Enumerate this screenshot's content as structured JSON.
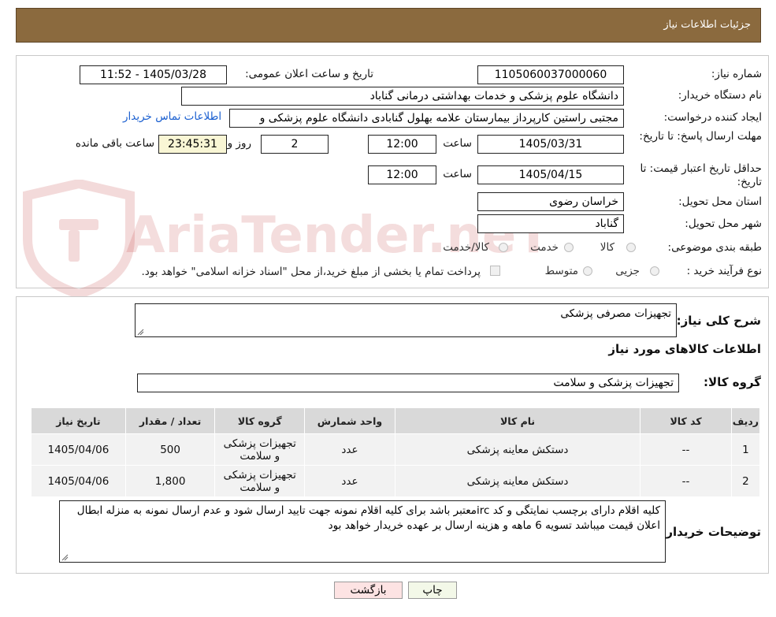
{
  "header": {
    "title": "جزئیات اطلاعات نیاز"
  },
  "watermark": {
    "text": "AriaTender.neT"
  },
  "form": {
    "need_number_label": "شماره نیاز:",
    "need_number": "1105060037000060",
    "announce_label": "تاریخ و ساعت اعلان عمومی:",
    "announce_value": "1405/03/28 - 11:52",
    "buyer_org_label": "نام دستگاه خریدار:",
    "buyer_org": "دانشگاه علوم پزشکی و خدمات بهداشتی درمانی گناباد",
    "creator_label": "ایجاد کننده درخواست:",
    "creator": "مجتبی راستین کارپرداز بیمارستان علامه بهلول گنابادی دانشگاه علوم پزشکی و",
    "contact_link": "اطلاعات تماس خریدار",
    "deadline_label": "مهلت ارسال پاسخ: تا تاریخ:",
    "deadline_date": "1405/03/31",
    "time_label": "ساعت",
    "deadline_time": "12:00",
    "days": "2",
    "days_label": "روز و",
    "remaining": "23:45:31",
    "remaining_label": "ساعت باقی مانده",
    "validity_label": "حداقل تاریخ اعتبار قیمت: تا تاریخ:",
    "validity_date": "1405/04/15",
    "validity_time": "12:00",
    "province_label": "استان محل تحویل:",
    "province": "خراسان رضوی",
    "city_label": "شهر محل تحویل:",
    "city": "گناباد",
    "category_label": "طبقه بندی موضوعی:",
    "category_options": [
      "کالا",
      "خدمت",
      "کالا/خدمت"
    ],
    "process_label": "نوع فرآیند خرید :",
    "process_options": [
      "جزیی",
      "متوسط"
    ],
    "process_note": "پرداخت تمام یا بخشی از مبلغ خرید،از محل \"اسناد خزانه اسلامی\" خواهد بود."
  },
  "summary": {
    "label": "شرح کلی نیاز:",
    "value": "تجهیزات مصرفی پزشکی",
    "goods_info_title": "اطلاعات کالاهای مورد نیاز",
    "group_label": "گروه کالا:",
    "group_value": "تجهیزات پزشکی و سلامت"
  },
  "table": {
    "headers": [
      "ردیف",
      "کد کالا",
      "نام کالا",
      "واحد شمارش",
      "گروه کالا",
      "تعداد / مقدار",
      "تاریخ نیاز"
    ],
    "rows": [
      [
        "1",
        "--",
        "دستکش معاینه پزشکی",
        "عدد",
        "تجهیزات پزشکی و سلامت",
        "500",
        "1405/04/06"
      ],
      [
        "2",
        "--",
        "دستکش معاینه پزشکی",
        "عدد",
        "تجهیزات پزشکی و سلامت",
        "1,800",
        "1405/04/06"
      ]
    ]
  },
  "buyer_notes": {
    "label": "توضیحات خریدار:",
    "value": "کلیه اقلام دارای برچسب نمایتگی و کد ircمعتبر باشد برای کلیه اقلام نمونه جهت تایید ارسال شود و عدم ارسال نمونه به منزله ابطال اعلان قیمت میباشد تسویه 6 ماهه و هزینه ارسال بر عهده خریدار خواهد بود"
  },
  "buttons": {
    "print": "چاپ",
    "back": "بازگشت"
  }
}
